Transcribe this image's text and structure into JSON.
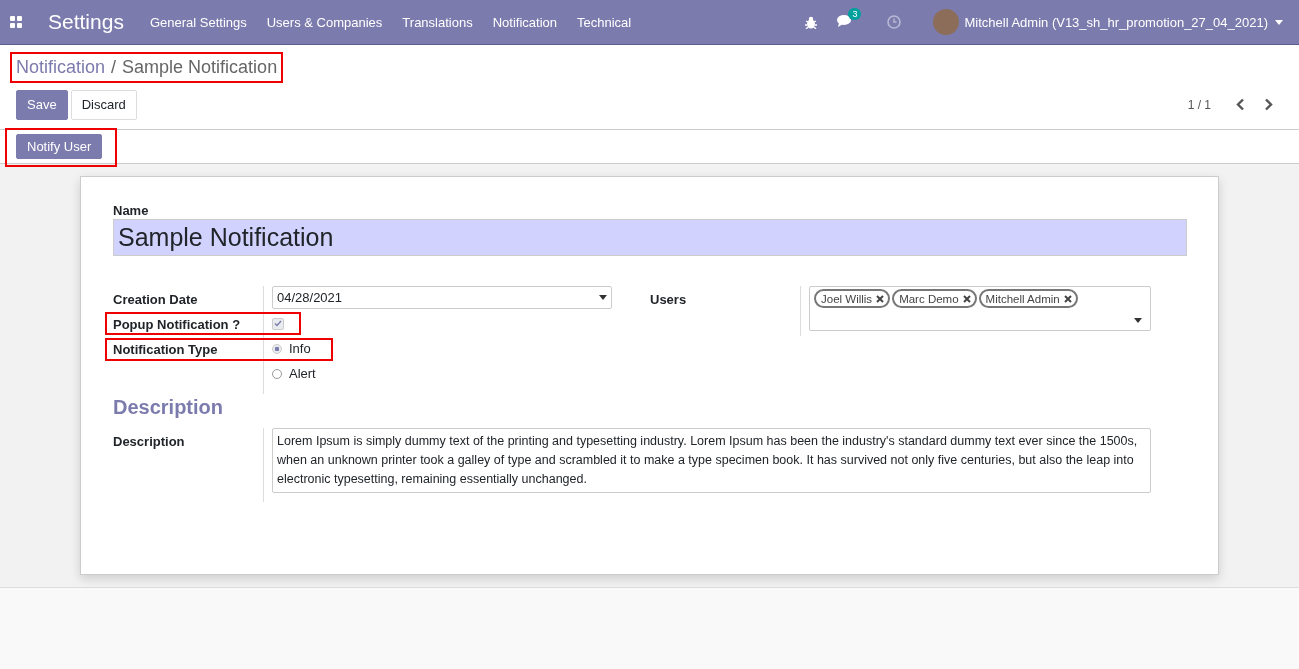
{
  "navbar": {
    "app_name": "Settings",
    "menu": [
      "General Settings",
      "Users & Companies",
      "Translations",
      "Notification",
      "Technical"
    ],
    "messages_badge": "3",
    "user_name": "Mitchell Admin (V13_sh_hr_promotion_27_04_2021)"
  },
  "breadcrumb": {
    "parent": "Notification",
    "separator": "/",
    "current": "Sample Notification",
    "highlighted": true
  },
  "buttons": [
    {
      "label": "Save",
      "kind": "primary"
    },
    {
      "label": "Discard",
      "kind": "secondary"
    }
  ],
  "pager": {
    "text": "1 / 1"
  },
  "statusbar": {
    "label": "Notify User",
    "highlighted": true
  },
  "form": {
    "name_label": "Name",
    "name_value": "Sample Notification",
    "creation_date": {
      "label": "Creation Date",
      "value": "04/28/2021"
    },
    "popup": {
      "label": "Popup Notification ?",
      "checked": true,
      "highlighted": true
    },
    "notification_type": {
      "label": "Notification Type",
      "highlighted": true,
      "options": [
        {
          "label": "Info",
          "selected": true
        },
        {
          "label": "Alert",
          "selected": false
        }
      ]
    },
    "users": {
      "label": "Users",
      "tags": [
        "Joel Willis",
        "Marc Demo",
        "Mitchell Admin"
      ]
    },
    "section_title": "Description",
    "description": {
      "label": "Description",
      "value": "Lorem Ipsum is simply dummy text of the printing and typesetting industry. Lorem Ipsum has been the industry's standard dummy text ever since the 1500s, when an unknown printer took a galley of type and scrambled it to make a type specimen book. It has survived not only five centuries, but also the leap into electronic typesetting, remaining essentially unchanged."
    }
  }
}
